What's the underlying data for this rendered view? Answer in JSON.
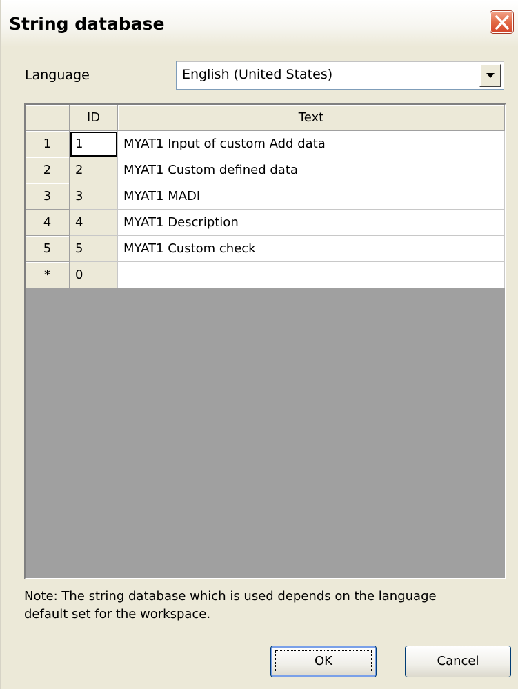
{
  "window": {
    "title": "String database",
    "close_icon": "close-icon"
  },
  "language": {
    "label": "Language",
    "selected": "English (United States)"
  },
  "grid": {
    "columns": [
      "",
      "ID",
      "Text"
    ],
    "rows": [
      {
        "num": "1",
        "id": "1",
        "text": "MYAT1 Input of custom Add data"
      },
      {
        "num": "2",
        "id": "2",
        "text": "MYAT1 Custom defined data"
      },
      {
        "num": "3",
        "id": "3",
        "text": "MYAT1 MADI"
      },
      {
        "num": "4",
        "id": "4",
        "text": "MYAT1 Description"
      },
      {
        "num": "5",
        "id": "5",
        "text": "MYAT1 Custom check"
      },
      {
        "num": "*",
        "id": "0",
        "text": ""
      }
    ]
  },
  "note": {
    "line1": "Note: The string database which is used depends on the language",
    "line2": "default set for the workspace."
  },
  "buttons": {
    "ok": "OK",
    "cancel": "Cancel"
  },
  "colors": {
    "dialog_bg": "#ece9d8",
    "close_button": "#d4452a",
    "grid_empty": "#a0a0a0"
  }
}
